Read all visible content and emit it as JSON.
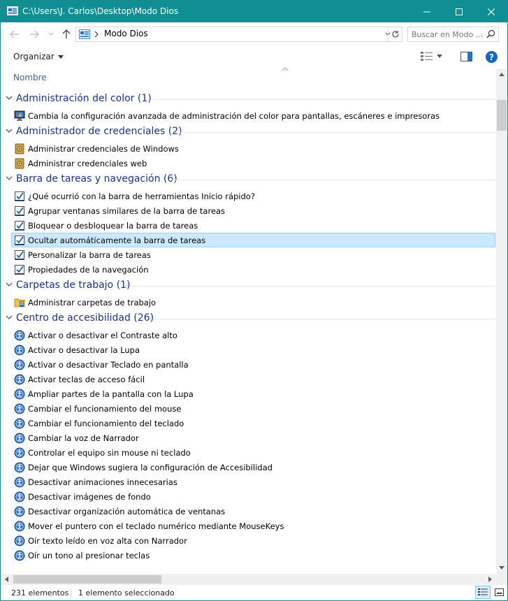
{
  "window": {
    "title": "C:\\Users\\J. Carlos\\Desktop\\Modo Dios",
    "accent_color": "#0f8f93"
  },
  "address": {
    "breadcrumb": "Modo Dios",
    "search_placeholder": "Buscar en Modo ..."
  },
  "command_bar": {
    "organize_label": "Organizar"
  },
  "columns": {
    "name": "Nombre"
  },
  "groups": [
    {
      "label": "Administración del color (1)",
      "icon": "color-management-icon",
      "items": [
        {
          "label": "Cambia la configuración avanzada de administración del color para pantallas, escáneres e impresoras"
        }
      ]
    },
    {
      "label": "Administrador de credenciales (2)",
      "icon": "credentials-vault-icon",
      "items": [
        {
          "label": "Administrar credenciales de Windows"
        },
        {
          "label": "Administrar credenciales web"
        }
      ]
    },
    {
      "label": "Barra de tareas y navegación (6)",
      "icon": "taskbar-checklist-icon",
      "items": [
        {
          "label": "¿Qué ocurrió con la barra de herramientas Inicio rápido?"
        },
        {
          "label": "Agrupar ventanas similares de la barra de tareas"
        },
        {
          "label": "Bloquear o desbloquear la barra de tareas"
        },
        {
          "label": "Ocultar automáticamente la barra de tareas",
          "selected": true
        },
        {
          "label": "Personalizar la barra de tareas"
        },
        {
          "label": "Propiedades de la navegación"
        }
      ]
    },
    {
      "label": "Carpetas de trabajo (1)",
      "icon": "work-folders-icon",
      "items": [
        {
          "label": "Administrar carpetas de trabajo"
        }
      ]
    },
    {
      "label": "Centro de accesibilidad (26)",
      "icon": "accessibility-icon",
      "items": [
        {
          "label": "Activar o desactivar el Contraste alto"
        },
        {
          "label": "Activar o desactivar la Lupa"
        },
        {
          "label": "Activar o desactivar Teclado en pantalla"
        },
        {
          "label": "Activar teclas de acceso fácil"
        },
        {
          "label": "Ampliar partes de la pantalla con la Lupa"
        },
        {
          "label": "Cambiar el funcionamiento del mouse"
        },
        {
          "label": "Cambiar el funcionamiento del teclado"
        },
        {
          "label": "Cambiar la voz de Narrador"
        },
        {
          "label": "Controlar el equipo sin mouse ni teclado"
        },
        {
          "label": "Dejar que Windows sugiera la configuración de Accesibilidad"
        },
        {
          "label": "Desactivar animaciones innecesarias"
        },
        {
          "label": "Desactivar imágenes de fondo"
        },
        {
          "label": "Desactivar organización automática de ventanas"
        },
        {
          "label": "Mover el puntero con el teclado numérico mediante MouseKeys"
        },
        {
          "label": "Oír texto leído en voz alta con Narrador"
        },
        {
          "label": "Oír un tono al presionar teclas"
        }
      ]
    }
  ],
  "status": {
    "count": "231 elementos",
    "selection": "1 elemento seleccionado"
  }
}
